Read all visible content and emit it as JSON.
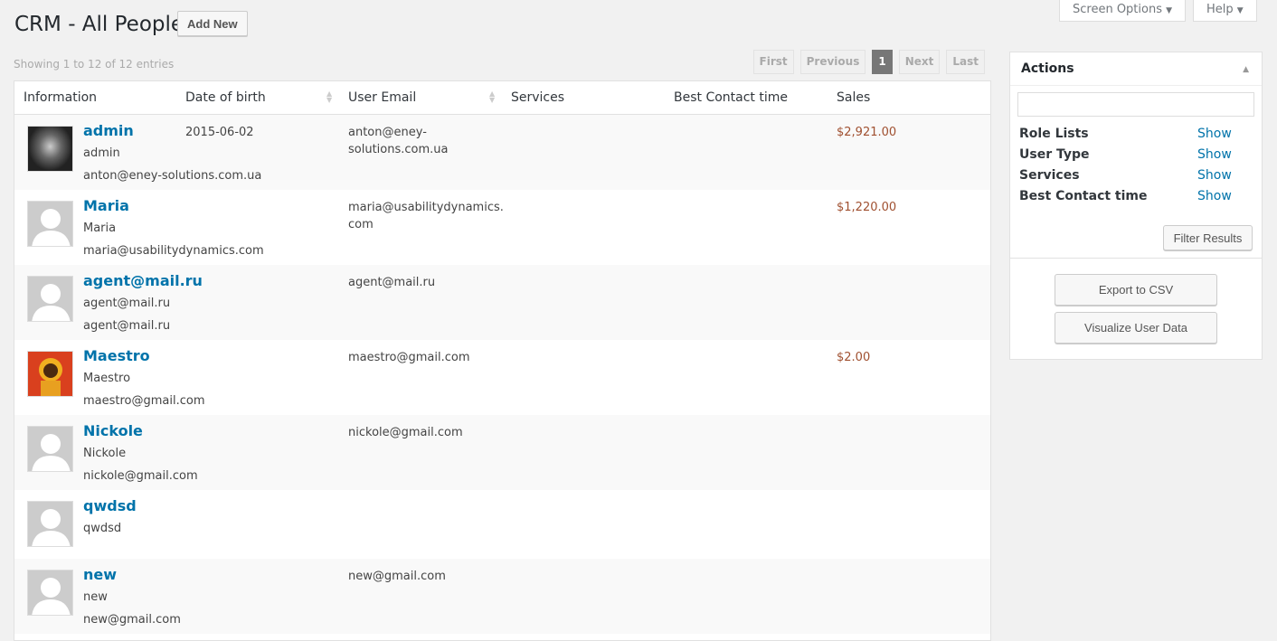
{
  "header": {
    "title": "CRM - All People",
    "add_new": "Add New",
    "screen_options": "Screen Options",
    "help": "Help"
  },
  "table": {
    "showing": "Showing 1 to 12 of 12 entries",
    "pager": {
      "first": "First",
      "previous": "Previous",
      "current": "1",
      "next": "Next",
      "last": "Last"
    },
    "columns": [
      "Information",
      "Date of birth",
      "User Email",
      "Services",
      "Best Contact time",
      "Sales"
    ],
    "rows": [
      {
        "name": "admin",
        "login": "admin",
        "email": "anton@eney-solutions.com.ua",
        "dob": "2015-06-02",
        "user_email": "anton@eney-\nsolutions.com.ua",
        "sales": "$2,921.00",
        "avatar": "photo"
      },
      {
        "name": "Maria",
        "login": "Maria",
        "email": "maria@usabilitydynamics.com",
        "dob": "",
        "user_email": "maria@usabilitydynamics.\ncom",
        "sales": "$1,220.00",
        "avatar": "default"
      },
      {
        "name": "agent@mail.ru",
        "login": "agent@mail.ru",
        "email": "agent@mail.ru",
        "dob": "",
        "user_email": "agent@mail.ru",
        "sales": "",
        "avatar": "default"
      },
      {
        "name": "Maestro",
        "login": "Maestro",
        "email": "maestro@gmail.com",
        "dob": "",
        "user_email": "maestro@gmail.com",
        "sales": "$2.00",
        "avatar": "icon"
      },
      {
        "name": "Nickole",
        "login": "Nickole",
        "email": "nickole@gmail.com",
        "dob": "",
        "user_email": "nickole@gmail.com",
        "sales": "",
        "avatar": "default"
      },
      {
        "name": "qwdsd",
        "login": "qwdsd",
        "email": "",
        "dob": "",
        "user_email": "",
        "sales": "",
        "avatar": "default"
      },
      {
        "name": "new",
        "login": "new",
        "email": "new@gmail.com",
        "dob": "",
        "user_email": "new@gmail.com",
        "sales": "",
        "avatar": "default"
      }
    ]
  },
  "sidebar": {
    "title": "Actions",
    "filters": [
      {
        "label": "Role Lists",
        "action": "Show"
      },
      {
        "label": "User Type",
        "action": "Show"
      },
      {
        "label": "Services",
        "action": "Show"
      },
      {
        "label": "Best Contact time",
        "action": "Show"
      }
    ],
    "filter_button": "Filter Results",
    "export_button": "Export to CSV",
    "visualize_button": "Visualize User Data"
  }
}
